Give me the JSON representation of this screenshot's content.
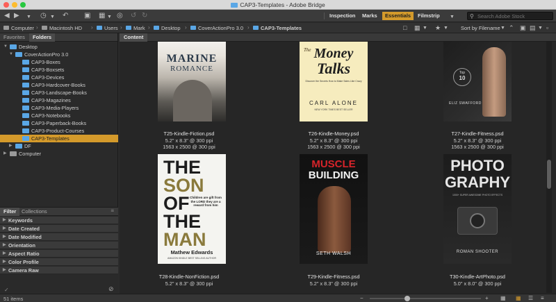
{
  "window": {
    "title": "CAP3-Templates - Adobe Bridge"
  },
  "toolbar": {
    "workspaces": [
      "Inspection",
      "Marks",
      "Essentials",
      "Filmstrip"
    ],
    "active_workspace": "Essentials",
    "search_placeholder": "Search Adobe Stock"
  },
  "pathbar": {
    "crumbs": [
      "Computer",
      "Macintosh HD",
      "Users",
      "Mark",
      "Desktop",
      "CoverActionPro 3.0",
      "CAP3-Templates"
    ],
    "sort_label": "Sort by Filename"
  },
  "left_panel": {
    "tabs": [
      "Favorites",
      "Folders"
    ],
    "active_tab": "Folders",
    "tree": [
      {
        "label": "Desktop"
      },
      {
        "label": "CoverActionPro 3.0"
      },
      {
        "label": "CAP3-Boxes"
      },
      {
        "label": "CAP3-Boxsets"
      },
      {
        "label": "CAP3-Devices"
      },
      {
        "label": "CAP3-Hardcover-Books"
      },
      {
        "label": "CAP3-Landscape-Books"
      },
      {
        "label": "CAP3-Magazines"
      },
      {
        "label": "CAP3-Media-Players"
      },
      {
        "label": "CAP3-Notebooks"
      },
      {
        "label": "CAP3-Paperback-Books"
      },
      {
        "label": "CAP3-Product-Courses"
      },
      {
        "label": "CAP3-Templates"
      },
      {
        "label": "DF"
      },
      {
        "label": "Computer"
      }
    ],
    "selected": "CAP3-Templates"
  },
  "filter_panel": {
    "tabs": [
      "Filter",
      "Collections"
    ],
    "rows": [
      "Keywords",
      "Date Created",
      "Date Modified",
      "Orientation",
      "Aspect Ratio",
      "Color Profile",
      "Camera Raw"
    ]
  },
  "content": {
    "tab_label": "Content",
    "items": [
      {
        "filename": "T25-Kindle-Fiction.psd",
        "size": "5.2\" x 8.3\" @ 300 ppi",
        "pixels": "1563 x 2500 @ 300 ppi",
        "cover": {
          "title1": "MARINE",
          "title2": "ROMANCE"
        }
      },
      {
        "filename": "T26-Kindle-Money.psd",
        "size": "5.2\" x 8.3\" @ 300 ppi",
        "pixels": "1563 x 2500 @ 300 ppi",
        "cover": {
          "title1": "Money",
          "title2": "Talks",
          "prefix": "The",
          "tagline": "Discover the Secrets How to Make Sales Like Crazy",
          "author": "CARL ALONE",
          "author_note": "NEW YORK TIMES BEST SELLER"
        }
      },
      {
        "filename": "T27-Kindle-Fitness.psd",
        "size": "5.2\" x 8.3\" @ 300 ppi",
        "pixels": "1563 x 2500 @ 300 ppi",
        "cover": {
          "badge_top": "Top",
          "badge_num": "10",
          "author": "ELIZ SWAFFORD"
        }
      },
      {
        "filename": "T28-Kindle-NonFiction.psd",
        "size": "5.2\" x 8.3\" @ 300 ppi",
        "pixels": "",
        "cover": {
          "the1": "THE",
          "son": "SON",
          "of": "OF",
          "the2": "THE",
          "man": "MAN",
          "quote": "Children are gift from the LORD they are a reward from him",
          "author": "Mathew Edwards",
          "note": "AMAZON KINDLE BEST SELLING AUTHOR"
        }
      },
      {
        "filename": "T29-Kindle-Fitness.psd",
        "size": "5.2\" x 8.3\" @ 300 ppi",
        "pixels": "",
        "cover": {
          "title1": "MUSCLE",
          "title2": "BUILDING",
          "author": "SETH WALSH"
        }
      },
      {
        "filename": "T30-Kindle-ArtPhoto.psd",
        "size": "5.0\" x 8.0\" @ 300 ppi",
        "pixels": "",
        "cover": {
          "title1": "PHOTO",
          "title2": "GRAPHY",
          "tagline": "1000+ SUPER AWESOME PHOTO EFFECTS",
          "author": "ROMAN SHOOTER"
        }
      }
    ]
  },
  "status": {
    "count": "51 items"
  },
  "colors": {
    "accent": "#d49a2b",
    "folder": "#5aa7e6",
    "panel": "#2a2a2a"
  }
}
